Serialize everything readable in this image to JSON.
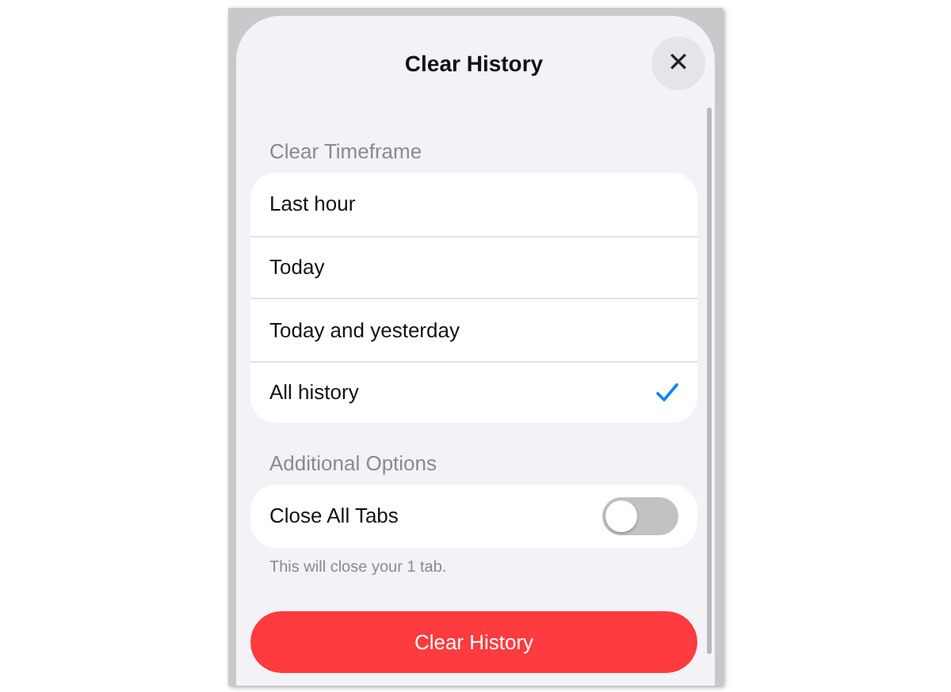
{
  "sheet": {
    "title": "Clear History",
    "close_label": "✕"
  },
  "timeframe": {
    "heading": "Clear Timeframe",
    "options": [
      {
        "label": "Last hour",
        "selected": false
      },
      {
        "label": "Today",
        "selected": false
      },
      {
        "label": "Today and yesterday",
        "selected": false
      },
      {
        "label": "All history",
        "selected": true
      }
    ]
  },
  "additional": {
    "heading": "Additional Options",
    "options": [
      {
        "label": "Close All Tabs",
        "on": false
      }
    ],
    "note": "This will close your 1 tab."
  },
  "action_button": "Clear History"
}
